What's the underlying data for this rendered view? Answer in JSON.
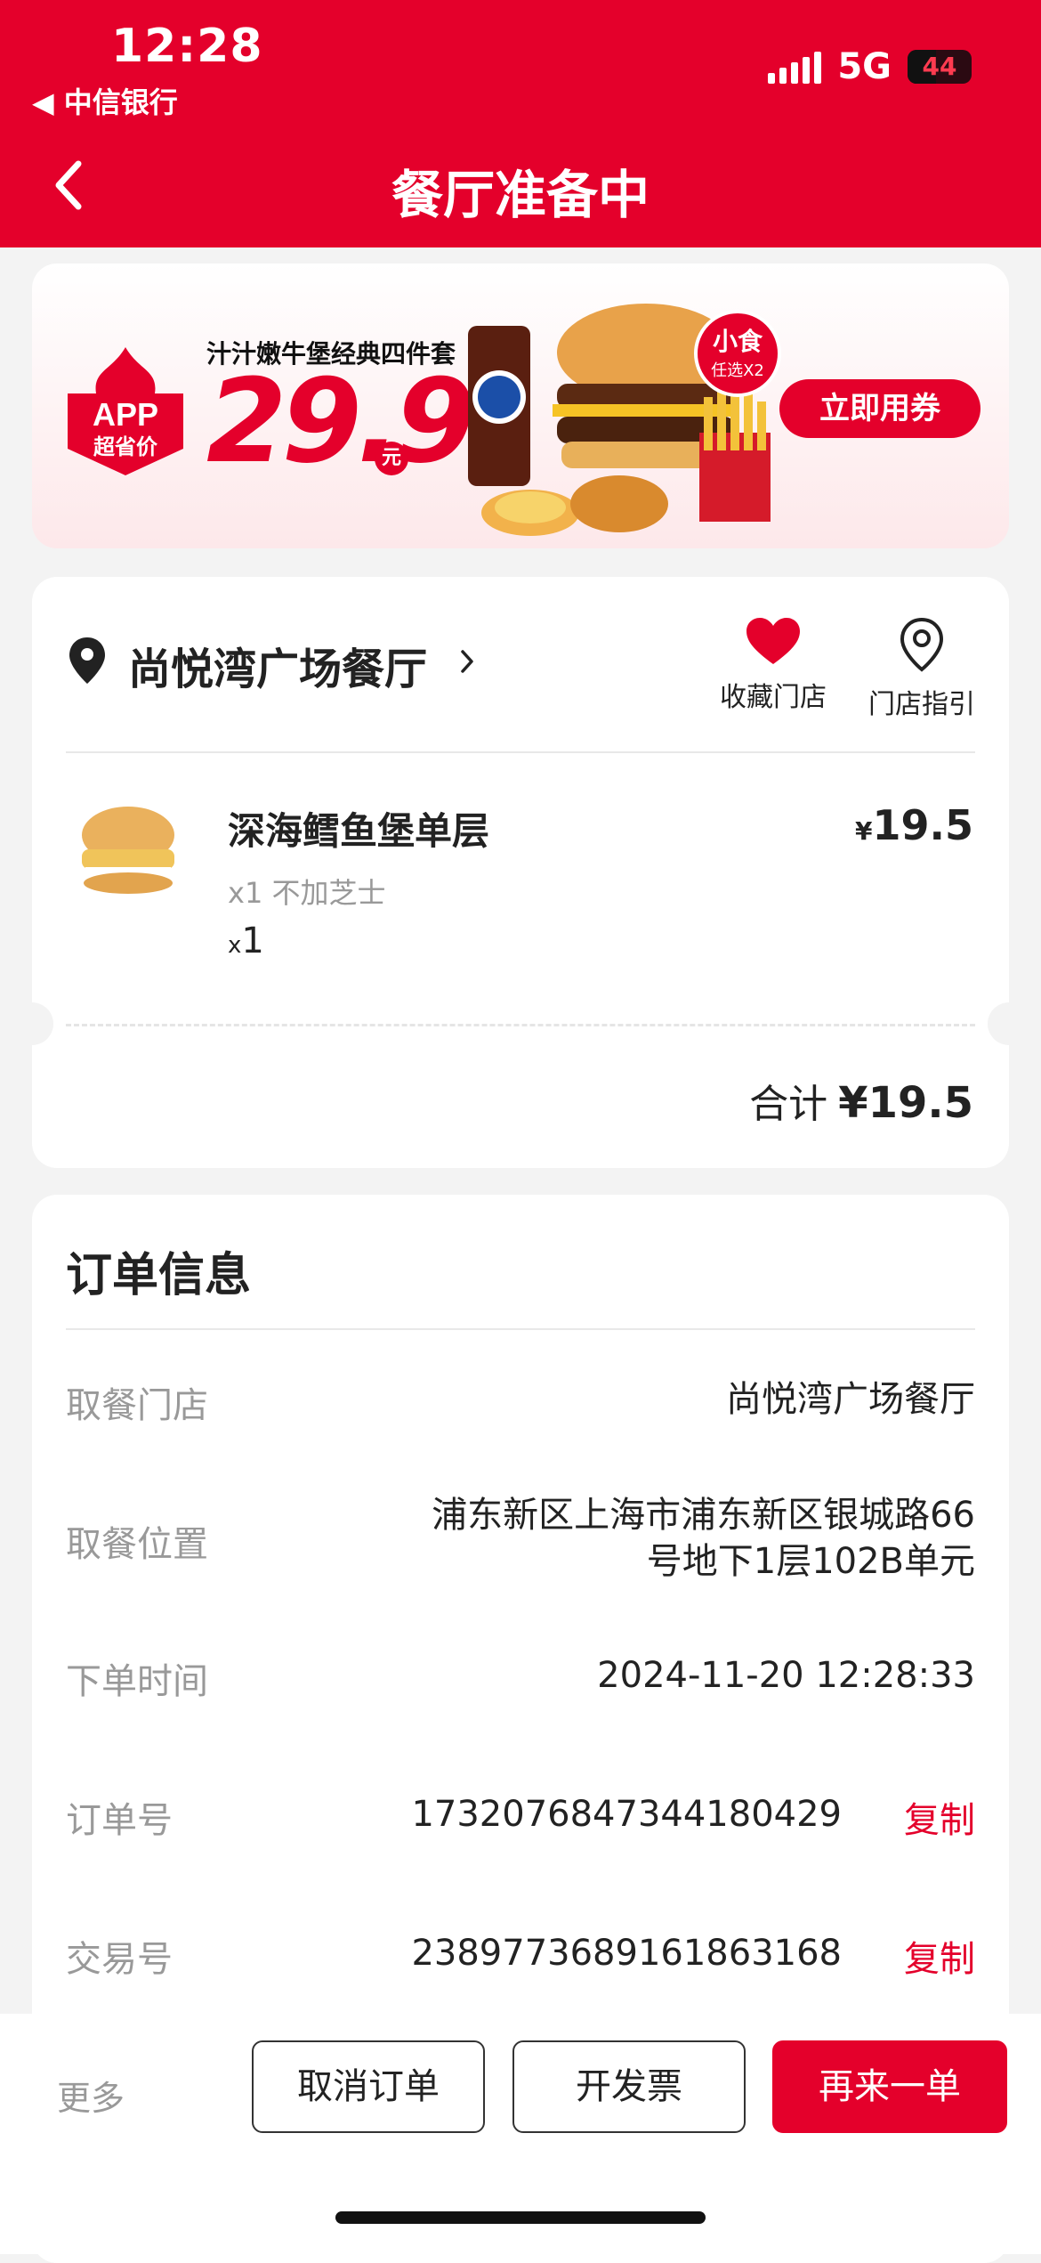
{
  "status_bar": {
    "time": "12:28",
    "back_app": "◀ 中信银行",
    "network": "5G",
    "battery": "44"
  },
  "header": {
    "title": "餐厅准备中"
  },
  "banner": {
    "promo_title": "汁汁嫩牛堡经典四件套",
    "price": "29.9",
    "yuan": "元",
    "app_badge_line1": "APP",
    "app_badge_line2": "超省价",
    "snack_line1": "小食",
    "snack_line2": "任选X2",
    "coupon_button": "立即用券"
  },
  "store": {
    "name": "尚悦湾广场餐厅",
    "favorite_label": "收藏门店",
    "guide_label": "门店指引"
  },
  "order_item": {
    "name": "深海鳕鱼堡单层",
    "option": "x1 不加芝士",
    "qty_prefix": "x",
    "qty": "1",
    "currency": "¥",
    "price": "19.5"
  },
  "total": {
    "label": "合计",
    "amount": "¥19.5"
  },
  "order_info": {
    "title": "订单信息",
    "rows": [
      {
        "label": "取餐门店",
        "value": "尚悦湾广场餐厅"
      },
      {
        "label": "取餐位置",
        "value_line1": "浦东新区上海市浦东新区银城路66",
        "value_line2": "号地下1层102B单元"
      },
      {
        "label": "下单时间",
        "value": "2024-11-20 12:28:33"
      },
      {
        "label": "订单号",
        "value": "1732076847344180429",
        "action": "复制"
      },
      {
        "label": "交易号",
        "value": "2389773689161863168",
        "action": "复制"
      }
    ]
  },
  "bottom_bar": {
    "more": "更多",
    "cancel": "取消订单",
    "invoice": "开发票",
    "reorder": "再来一单"
  },
  "colors": {
    "brand_red": "#e4002b",
    "background": "#f3f3f3"
  }
}
